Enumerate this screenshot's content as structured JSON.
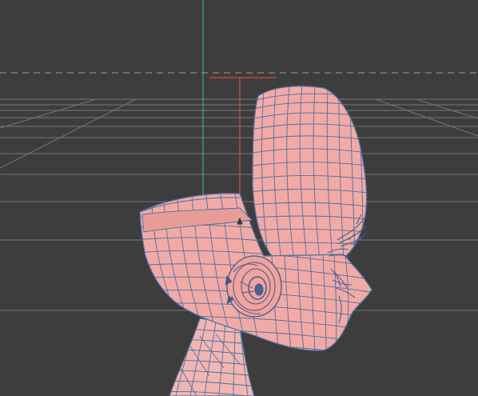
{
  "viewport": {
    "background": "#3d3d3d",
    "grid_color": "#8a8f96",
    "horizon_dash_color": "#9a9a9a",
    "y_axis_color": "#3fbf7f",
    "x_axis_color": "#d94a4a"
  },
  "model": {
    "surface_color": "#f2aaa6",
    "wire_color": "#4f6fa0",
    "parts": [
      "head-mesh",
      "cranium-mesh",
      "face-mesh",
      "ear-mesh",
      "neck-mesh",
      "eyelash-mesh"
    ]
  },
  "gizmo": {
    "icons": [
      "transform-gizmo-icon",
      "pivot-marker-icon"
    ]
  }
}
